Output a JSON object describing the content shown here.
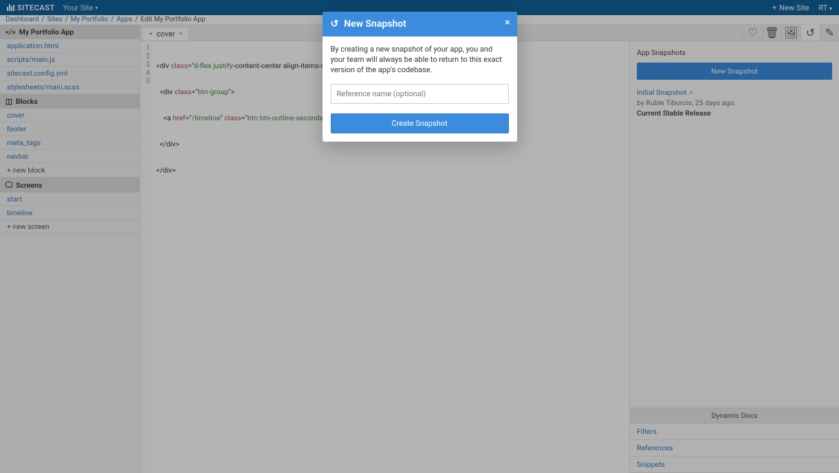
{
  "topnav": {
    "brand": "SITECAST",
    "your_site": "Your Site",
    "new_site": "New Site",
    "user": "RT"
  },
  "breadcrumb": [
    {
      "label": "Dashboard",
      "link": true
    },
    {
      "label": "Sites",
      "link": true
    },
    {
      "label": "My Portfolio",
      "link": true
    },
    {
      "label": "Apps",
      "link": true
    },
    {
      "label": "Edit My Portfolio App",
      "link": false
    }
  ],
  "sidebar": {
    "app_title": "My Portfolio App",
    "files": [
      "application.html",
      "scripts/main.js",
      "sitecast.config.yml",
      "stylesheets/main.scss"
    ],
    "blocks_heading": "Blocks",
    "blocks": [
      "cover",
      "footer",
      "meta_tags",
      "navbar"
    ],
    "add_block": "+ new block",
    "screens_heading": "Screens",
    "screens": [
      "start",
      "timeline"
    ],
    "add_screen": "+ new screen"
  },
  "editor": {
    "tab": "cover",
    "gutter": [
      "1",
      "2",
      "3",
      "4",
      "5"
    ],
    "code": {
      "l1": {
        "a": "<div ",
        "b": "class",
        "c": "=\"",
        "d": "d-flex justify",
        "e": "-content-center align-items-ce"
      },
      "l2": {
        "a": "  <div ",
        "b": "class",
        "c": "=\"",
        "d": "btn-group",
        "e": "\">"
      },
      "l3": {
        "a": "    <a ",
        "b": "href",
        "c": "=\"",
        "d": "/timeline",
        "e": "\" ",
        "f": "class",
        "g": "=\"",
        "h": "btn btn-outline-secondary"
      },
      "l4": "  </div>",
      "l5": "</div>"
    }
  },
  "rightpanel": {
    "section_title": "App Snapshots",
    "new_btn": "New Snapshot",
    "snapshot": {
      "title": "Initial Snapshot",
      "by": "by Ruble Tiburcio, 25 days ago.",
      "current": "Current Stable Release"
    },
    "docs_heading": "Dynamic Docs",
    "docs": [
      "Filters",
      "References",
      "Snippets"
    ]
  },
  "modal": {
    "title": "New Snapshot",
    "body": "By creating a new snapshot of your app, you and your team will always be able to return to this exact version of the app's codebase.",
    "placeholder": "Reference name (optional)",
    "submit": "Create Snapshot"
  }
}
